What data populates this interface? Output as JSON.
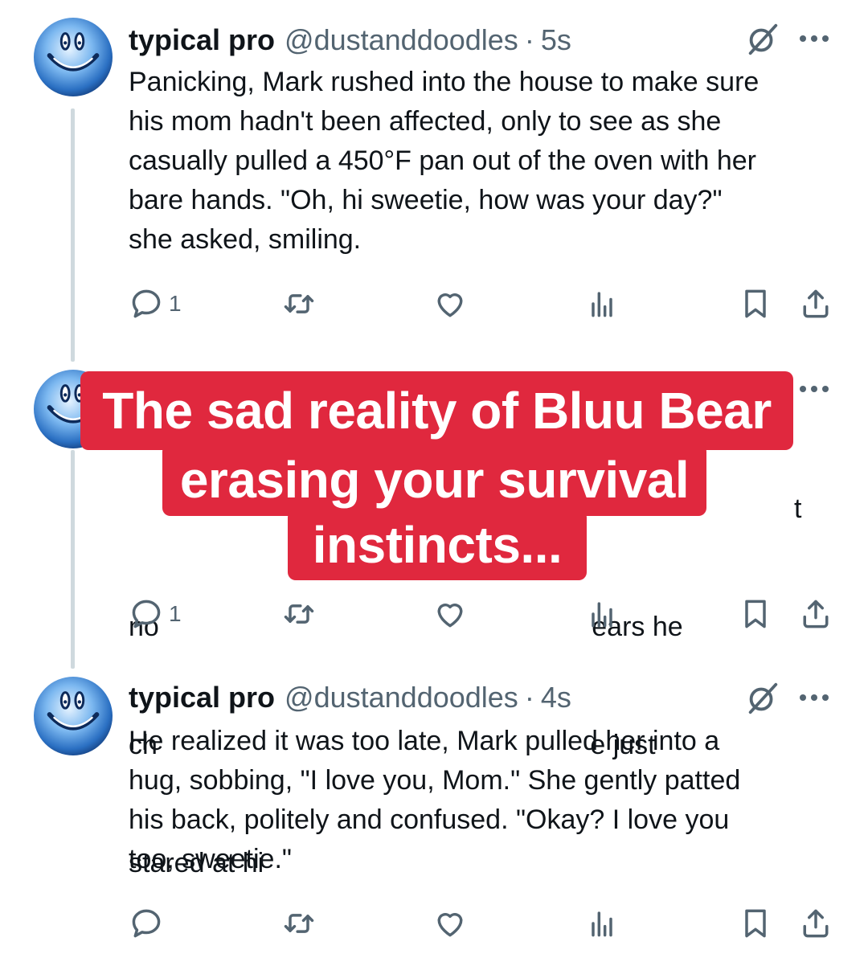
{
  "tweets": [
    {
      "name": "typical pro",
      "handle": "@dustanddoodles",
      "separator": "·",
      "time": "5s",
      "lines": [
        "Panicking, Mark rushed into the house to make sure",
        "his mom hadn't been affected, only to see as she",
        "casually pulled a 450°F pan out of the oven with her",
        "bare hands. \"Oh, hi sweetie, how was your day?\"",
        "she asked, smiling."
      ],
      "reply_count": "1"
    },
    {
      "lines": [
        "t",
        "no                                                         ears he",
        "ch                                                         e just",
        "stared at hi"
      ],
      "reply_count": "1"
    },
    {
      "name": "typical pro",
      "handle": "@dustanddoodles",
      "separator": "·",
      "time": "4s",
      "lines": [
        "He realized it was too late, Mark pulled her into a",
        "hug, sobbing, \"I love you, Mom.\" She gently patted",
        "his back, politely and confused. \"Okay? I love you",
        "too, sweetie.\""
      ],
      "reply_count": ""
    }
  ],
  "overlay": {
    "lines": [
      "The sad reality of Bluu Bear",
      "erasing your survival",
      "instincts..."
    ],
    "color": "#e0283e"
  },
  "icons": [
    "reply-icon",
    "retweet-icon",
    "like-icon",
    "views-icon",
    "bookmark-icon",
    "share-icon",
    "grok-icon",
    "more-icon"
  ],
  "colors": {
    "text": "#0f1419",
    "secondary": "#536471",
    "thread_line": "#cfd9de",
    "avatar_blue": "#2a6fc2"
  }
}
